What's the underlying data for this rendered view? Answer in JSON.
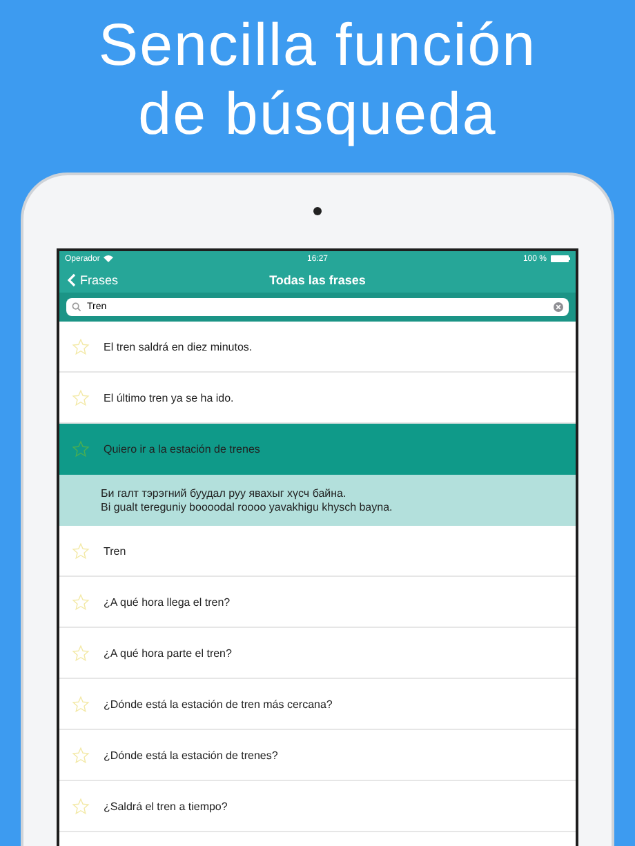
{
  "headline": [
    "Sencilla función",
    "de búsqueda"
  ],
  "status_bar": {
    "carrier": "Operador",
    "time": "16:27",
    "battery": "100 %"
  },
  "nav": {
    "back": "Frases",
    "title": "Todas las frases"
  },
  "search": {
    "value": "Tren"
  },
  "rows": [
    {
      "kind": "phrase",
      "text": "El tren saldrá en diez minutos.",
      "selected": false
    },
    {
      "kind": "phrase",
      "text": "El último tren ya se ha ido.",
      "selected": false
    },
    {
      "kind": "phrase",
      "text": "Quiero ir a la estación de trenes",
      "selected": true
    },
    {
      "kind": "translation",
      "lines": [
        "Би галт тэрэгний буудал руу явахыг хүсч байна.",
        "Bi gualt tereguniy boooodal roooo yavakhigu khysch bayna."
      ]
    },
    {
      "kind": "phrase",
      "text": "Tren",
      "selected": false
    },
    {
      "kind": "phrase",
      "text": "¿A qué hora llega el tren?",
      "selected": false
    },
    {
      "kind": "phrase",
      "text": "¿A qué hora parte el tren?",
      "selected": false
    },
    {
      "kind": "phrase",
      "text": "¿Dónde está la estación de tren más cercana?",
      "selected": false
    },
    {
      "kind": "phrase",
      "text": "¿Dónde está la estación de trenes?",
      "selected": false
    },
    {
      "kind": "phrase",
      "text": "¿Saldrá el tren a tiempo?",
      "selected": false
    }
  ]
}
